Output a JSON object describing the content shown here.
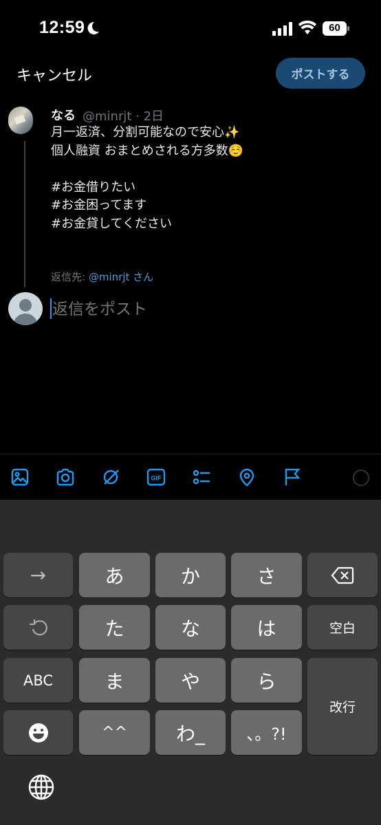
{
  "status_bar": {
    "time": "12:59",
    "battery": "60"
  },
  "header": {
    "cancel_label": "キャンセル",
    "post_label": "ポストする"
  },
  "tweet": {
    "author_name": "なる",
    "handle_time": "@minrjt · 2日",
    "body": "月一返済、分割可能なので安心✨\n個人融資 おまとめされる方多数☺️\n\n#お金借りたい\n#お金困ってます\n#お金貸してください",
    "reply_prefix": "返信先: ",
    "reply_mention": "@minrjt さん"
  },
  "compose": {
    "placeholder": "返信をポスト"
  },
  "toolbar": {
    "icons": [
      "image-icon",
      "camera-icon",
      "grok-icon",
      "gif-icon",
      "poll-icon",
      "location-icon",
      "flag-icon"
    ],
    "accent": "#1d9bf0"
  },
  "keyboard": {
    "rows": [
      [
        "→",
        "あ",
        "か",
        "さ",
        "⌫"
      ],
      [
        "↺",
        "た",
        "な",
        "は",
        "空白"
      ],
      [
        "ABC",
        "ま",
        "や",
        "ら",
        "改行"
      ],
      [
        "☻",
        "^^",
        "わ_",
        "、。?!"
      ]
    ]
  }
}
